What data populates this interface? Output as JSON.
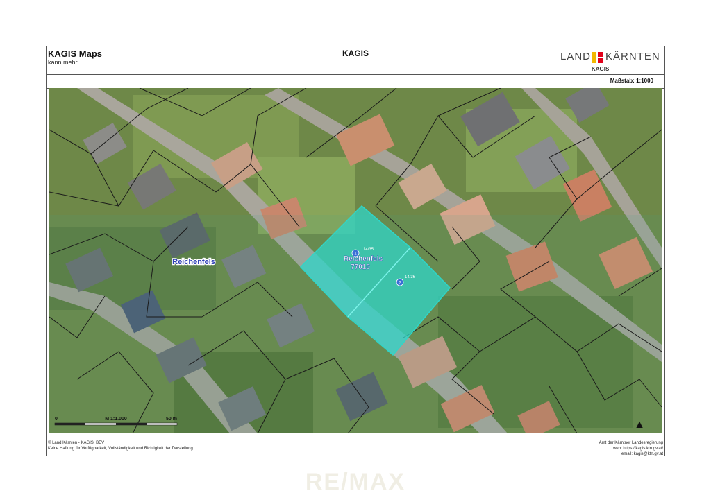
{
  "header": {
    "app_title": "KAGIS Maps",
    "app_subtitle": "kann mehr...",
    "center_title": "KAGIS",
    "logo_land": "LAND",
    "logo_kaernten": "KÄRNTEN",
    "logo_kagis": "KAGIS"
  },
  "scale": {
    "label": "Maßstab:",
    "value": "1:1000"
  },
  "map": {
    "place_label": "Reichenfels",
    "parcel_name": "Reichenfels",
    "parcel_code": "77010",
    "parcel_1_number": "14/35",
    "parcel_1_marker": "1",
    "parcel_2_number": "14/36",
    "parcel_2_marker": "2",
    "scalebar_zero": "0",
    "scalebar_ratio": "M 1:1.000",
    "scalebar_max": "50 m",
    "north_arrow": "▲",
    "colors": {
      "parcel_fill": "#2fd6c8",
      "boundary": "#1a1a1a",
      "label_blue": "#2d3fb5"
    }
  },
  "footer": {
    "left_line1": "© Land Kärnten - KAGIS, BEV",
    "left_line2": "Keine Haftung für Verfügbarkeit, Vollständigkeit und Richtigkeit der Darstellung.",
    "right_line1": "Amt der Kärntner Landesregierung",
    "right_line2": "web: https://kagis.ktn.gv.at/",
    "right_line3": "email: kagis@ktn.gv.at"
  },
  "watermark": "RE/MAX"
}
